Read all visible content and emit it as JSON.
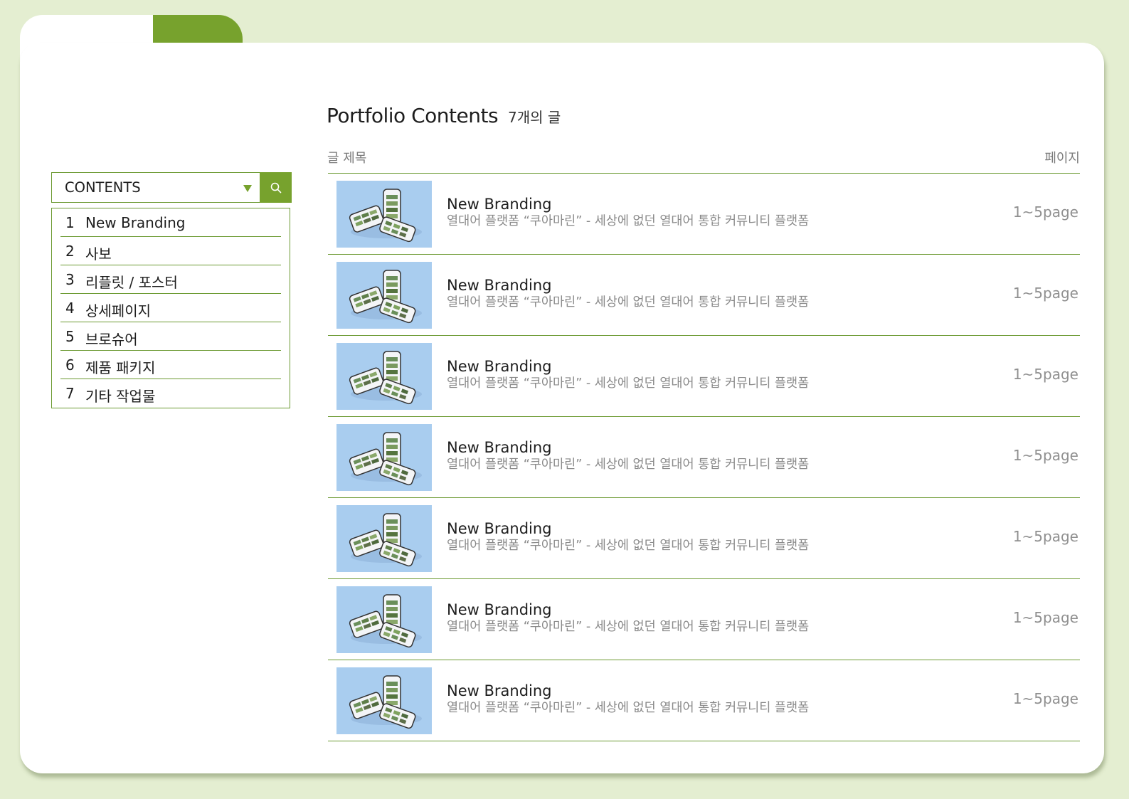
{
  "header": {
    "title": "Portfolio Contents",
    "count": "7개의 글"
  },
  "columns": {
    "title": "글 제목",
    "pages": "페이지"
  },
  "search": {
    "label": "CONTENTS"
  },
  "toc": [
    {
      "num": "1",
      "label": "New Branding"
    },
    {
      "num": "2",
      "label": "사보"
    },
    {
      "num": "3",
      "label": "리플릿 / 포스터"
    },
    {
      "num": "4",
      "label": "상세페이지"
    },
    {
      "num": "5",
      "label": "브로슈어"
    },
    {
      "num": "6",
      "label": "제품 패키지"
    },
    {
      "num": "7",
      "label": "기타 작업물"
    }
  ],
  "posts": [
    {
      "title": "New Branding",
      "desc": "열대어 플랫폼 “쿠아마린” - 세상에 없던 열대어 통합 커뮤니티 플랫폼",
      "pages": "1~5page"
    },
    {
      "title": "New Branding",
      "desc": "열대어 플랫폼 “쿠아마린” - 세상에 없던 열대어 통합 커뮤니티 플랫폼",
      "pages": "1~5page"
    },
    {
      "title": "New Branding",
      "desc": "열대어 플랫폼 “쿠아마린” - 세상에 없던 열대어 통합 커뮤니티 플랫폼",
      "pages": "1~5page"
    },
    {
      "title": "New Branding",
      "desc": "열대어 플랫폼 “쿠아마린” - 세상에 없던 열대어 통합 커뮤니티 플랫폼",
      "pages": "1~5page"
    },
    {
      "title": "New Branding",
      "desc": "열대어 플랫폼 “쿠아마린” - 세상에 없던 열대어 통합 커뮤니티 플랫폼",
      "pages": "1~5page"
    },
    {
      "title": "New Branding",
      "desc": "열대어 플랫폼 “쿠아마린” - 세상에 없던 열대어 통합 커뮤니티 플랫폼",
      "pages": "1~5page"
    },
    {
      "title": "New Branding",
      "desc": "열대어 플랫폼 “쿠아마린” - 세상에 없던 열대어 통합 커뮤니티 플랫폼",
      "pages": "1~5page"
    }
  ],
  "colors": {
    "accent": "#77a22d",
    "background": "#e4eed1",
    "thumbnail": "#a9cdef"
  },
  "icons": {
    "search": "search-icon",
    "dropdown": "caret-down-icon",
    "thumbnail": "phone-mockup-icon"
  }
}
